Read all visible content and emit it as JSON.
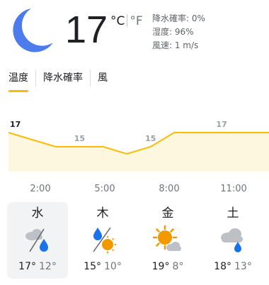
{
  "current": {
    "icon": "moon-icon",
    "temperature": "17",
    "unit_celsius": "°C",
    "unit_fahrenheit": "°F",
    "precipitation": "降水確率: 0%",
    "humidity": "湿度: 96%",
    "wind": "風速: 1 m/s"
  },
  "tabs": [
    {
      "label": "温度",
      "active": true
    },
    {
      "label": "降水確率",
      "active": false
    },
    {
      "label": "風",
      "active": false
    }
  ],
  "accent_color": "#fbbc04",
  "chart_data": {
    "type": "area",
    "x": [
      "2:00",
      "5:00",
      "8:00",
      "11:00"
    ],
    "values": [
      17,
      16,
      15,
      15,
      15,
      14,
      15,
      17,
      17,
      17,
      17,
      17
    ],
    "point_labels": [
      {
        "index": 0,
        "label": "17"
      },
      {
        "index": 3,
        "label": "15"
      },
      {
        "index": 6,
        "label": "15"
      },
      {
        "index": 9,
        "label": "17"
      }
    ],
    "ylim": [
      13,
      19
    ],
    "grid": false,
    "color": "#fbbc04",
    "fill": "#fef7e0"
  },
  "time_labels": [
    "2:00",
    "5:00",
    "8:00",
    "11:00"
  ],
  "days": [
    {
      "name": "水",
      "icon": "cloud-rain-icon",
      "high": "17°",
      "low": "12°",
      "selected": true
    },
    {
      "name": "木",
      "icon": "sun-rain-split-icon",
      "high": "15°",
      "low": "10°",
      "selected": false
    },
    {
      "name": "金",
      "icon": "sun-cloud-icon",
      "high": "19°",
      "low": "8°",
      "selected": false
    },
    {
      "name": "土",
      "icon": "cloud-shower-icon",
      "high": "18°",
      "low": "13°",
      "selected": false
    }
  ]
}
